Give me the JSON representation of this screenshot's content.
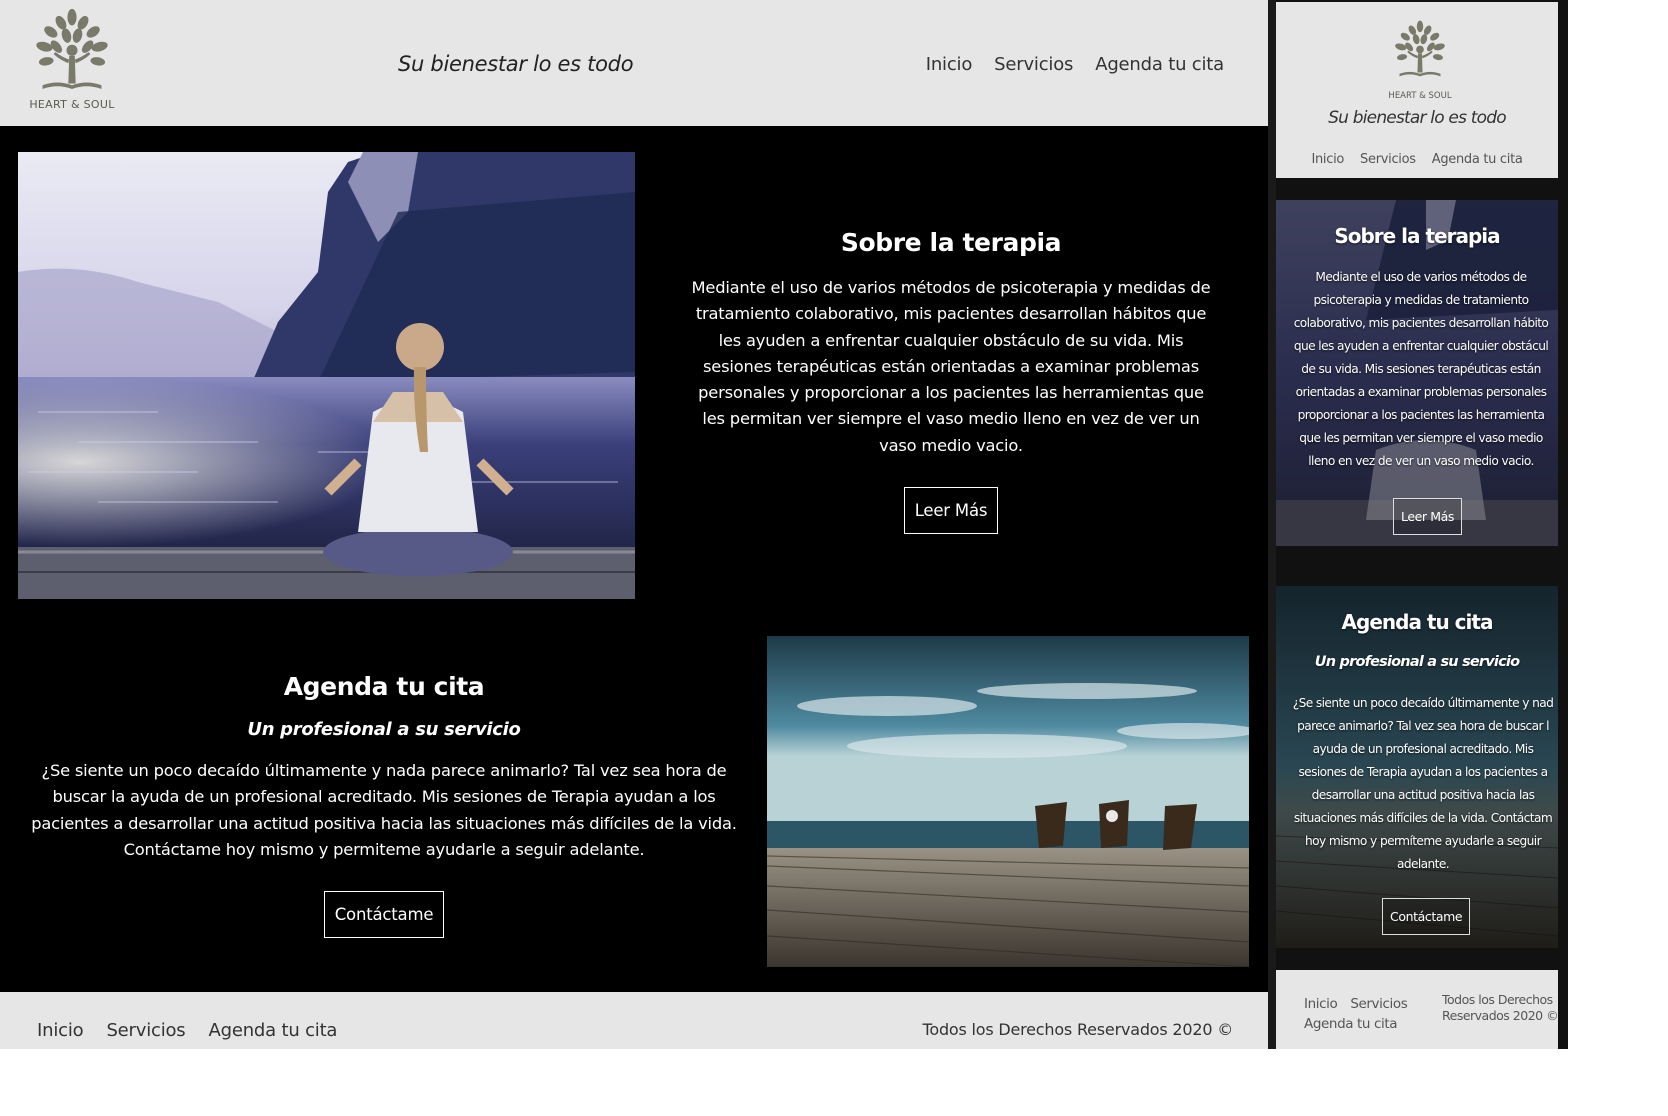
{
  "brand": {
    "logo_text": "HEART & SOUL",
    "tagline": "Su bienestar lo es todo",
    "colors": {
      "header_bg": "#e6e6e6",
      "body_bg": "#000000",
      "logo": "#7a7a6a",
      "text_light": "#ffffff",
      "text_dark": "#333333"
    }
  },
  "nav": {
    "items": [
      {
        "label": "Inicio"
      },
      {
        "label": "Servicios"
      },
      {
        "label": "Agenda tu cita"
      }
    ]
  },
  "therapy": {
    "title": "Sobre la terapia",
    "body": "Mediante el uso de varios métodos de psicoterapia y medidas de tratamiento colaborativo, mis pacientes desarrollan hábitos que les ayuden a enfrentar cualquier obstáculo de su vida. Mis sesiones terapéuticas están orientadas a examinar problemas personales y proporcionar a los pacientes las herramientas que les permitan ver siempre el vaso medio lleno en vez de ver un vaso medio vacio.",
    "button_label": "Leer Más"
  },
  "appointment": {
    "title": "Agenda tu cita",
    "subtitle": "Un profesional a su servicio",
    "body": "¿Se siente un poco decaído últimamente y nada parece animarlo? Tal vez sea hora de buscar la ayuda de un profesional acreditado. Mis sesiones de Terapia ayudan a los pacientes a desarrollar una actitud positiva hacia las situaciones más difíciles de la vida. Contáctame hoy mismo y permiteme ayudarle a seguir adelante.",
    "button_label": "Contáctame"
  },
  "footer": {
    "nav": [
      {
        "label": "Inicio"
      },
      {
        "label": "Servicios"
      },
      {
        "label": "Agenda tu cita"
      }
    ],
    "copyright": "Todos los Derechos Reservados 2020 ©"
  },
  "mobile": {
    "therapy_lines": [
      "Mediante el uso de varios métodos de",
      "psicoterapia y medidas de tratamiento",
      "colaborativo, mis pacientes desarrollan hábito",
      "que les ayuden a enfrentar cualquier obstácul",
      "de su vida. Mis sesiones terapéuticas están",
      "orientadas a examinar problemas personales",
      "proporcionar a los pacientes las herramienta",
      "que les permitan ver siempre el vaso medio",
      "lleno en vez de ver un vaso medio vacio."
    ],
    "appointment_lines": [
      "¿Se siente un poco decaído últimamente y nad",
      "parece animarlo? Tal vez sea hora de buscar l",
      "ayuda de un profesional acreditado. Mis",
      "sesiones de Terapia ayudan a los pacientes a",
      "desarrollar una actitud positiva hacia las",
      "situaciones más difíciles de la vida. Contáctam",
      "hoy mismo y permíteme ayudarle a seguir",
      "adelante."
    ],
    "copyright_lines": [
      "Todos los Derechos",
      "Reservados 2020 ©"
    ]
  }
}
